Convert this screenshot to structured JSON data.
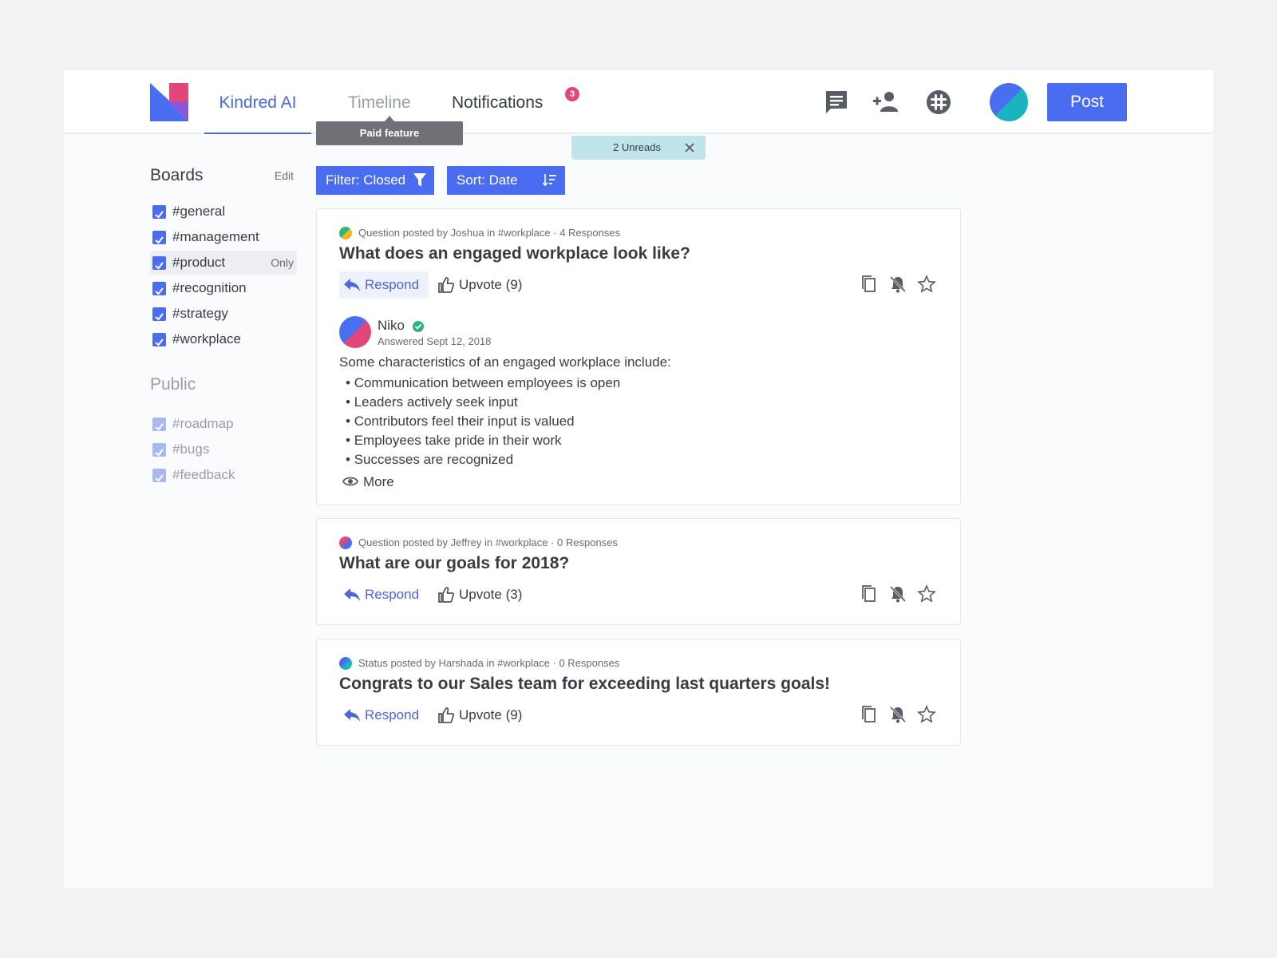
{
  "nav": {
    "brand_tab": "Kindred AI",
    "timeline_tab": "Timeline",
    "notifications_tab": "Notifications",
    "notifications_count": "3",
    "paid_tooltip": "Paid feature",
    "post_label": "Post"
  },
  "unreads": {
    "label": "2 Unreads"
  },
  "sidebar": {
    "boards_title": "Boards",
    "edit_label": "Edit",
    "boards": [
      {
        "label": "#general"
      },
      {
        "label": "#management"
      },
      {
        "label": "#product",
        "only": "Only"
      },
      {
        "label": "#recognition"
      },
      {
        "label": "#strategy"
      },
      {
        "label": "#workplace"
      }
    ],
    "public_title": "Public",
    "public_boards": [
      {
        "label": "#roadmap"
      },
      {
        "label": "#bugs"
      },
      {
        "label": "#feedback"
      }
    ]
  },
  "toolbar": {
    "filter_label": "Filter: Closed",
    "sort_label": "Sort: Date"
  },
  "posts": [
    {
      "meta": "Question posted by Joshua in #workplace · 4 Responses",
      "title": "What does an engaged workplace look like?",
      "respond": "Respond",
      "upvote": "Upvote (9)",
      "answer": {
        "name": "Niko",
        "date": "Answered Sept 12, 2018",
        "intro": "Some characteristics of an engaged workplace include:",
        "items": [
          "Communication between employees is open",
          "Leaders actively seek input",
          "Contributors feel their input is valued",
          "Employees take pride in their work",
          "Successes are recognized"
        ],
        "more": "More"
      }
    },
    {
      "meta": "Question posted by Jeffrey in #workplace · 0 Responses",
      "title": "What are our goals for 2018?",
      "respond": "Respond",
      "upvote": "Upvote (3)"
    },
    {
      "meta": "Status posted by Harshada in #workplace · 0 Responses",
      "title": "Congrats to our Sales team for exceeding last quarters goals!",
      "respond": "Respond",
      "upvote": "Upvote (9)"
    }
  ],
  "colors": {
    "accent": "#4a6cf0",
    "badge": "#e0467a",
    "verified": "#2ab57d"
  },
  "icons": [
    "chat-icon",
    "add-user-icon",
    "slack-icon",
    "copy-icon",
    "mute-bell-icon",
    "star-icon",
    "reply-icon",
    "thumbs-up-icon",
    "eye-icon",
    "filter-icon",
    "sort-icon",
    "close-icon"
  ]
}
